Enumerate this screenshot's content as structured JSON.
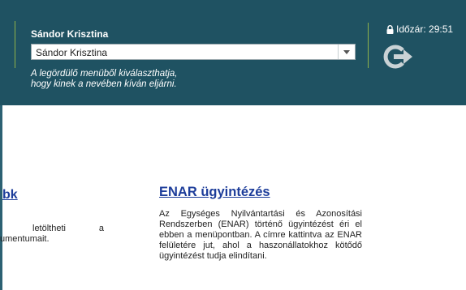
{
  "header": {
    "user_title": "Sándor Krisztina",
    "select_value": "Sándor Krisztina",
    "help_line1": "A legördülő menüből kiválaszthatja,",
    "help_line2": "hogy kinek a nevében kíván eljárni.",
    "timer": "Időzár: 29:51",
    "colors": {
      "header_bg": "#1f5262",
      "accent": "#8fb14a"
    }
  },
  "left_card": {
    "title": "bk",
    "line1_a": "letöltheti",
    "line1_b": "a",
    "line2": "umentumait."
  },
  "enar_card": {
    "title": "ENAR ügyintézés",
    "body": "Az Egységes Nyilvántartási és Azonosítási Rendszerben (ENAR) történő ügyintézést éri el ebben a menüpontban. A címre kattintva az ENAR felületére jut, ahol a haszonállatokhoz kötődő ügyintézést tudja elindítani."
  },
  "icons": [
    "lock-icon",
    "chevron-down-icon",
    "logout-icon"
  ]
}
